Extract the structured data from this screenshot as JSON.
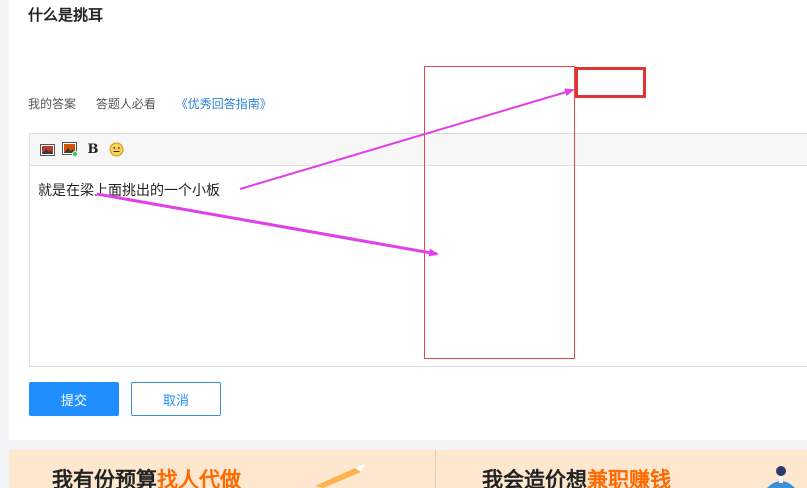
{
  "question": {
    "title": "什么是挑耳"
  },
  "answer_bar": {
    "my_answer": "我的答案",
    "must_read": "答题人必看",
    "guide_link": "《优秀回答指南》"
  },
  "editor": {
    "toolbar": {
      "image_icon": "image-icon",
      "picture_insert_icon": "insert-picture-icon",
      "bold_label": "B",
      "emoji_icon": "emoji-icon"
    },
    "content": "就是在梁上面挑出的一个小板"
  },
  "actions": {
    "submit_label": "提交",
    "cancel_label": "取消"
  },
  "banner": {
    "left": {
      "prefix": "我有份预算",
      "highlight": "找人代做"
    },
    "right": {
      "prefix": "我会造价想",
      "highlight": "兼职赚钱"
    }
  },
  "colors": {
    "accent": "#1f8fff",
    "annotation_box": "#e03535",
    "annotation_arrow": "#e040e8",
    "promo_highlight": "#ff6a00"
  }
}
